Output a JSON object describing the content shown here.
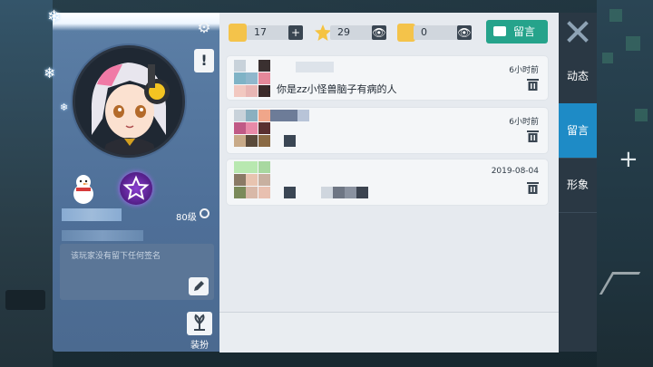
{
  "stats": {
    "home_count": "17",
    "star_count": "29",
    "gift_count": "0"
  },
  "message_button": {
    "label": "留言"
  },
  "tabs": [
    {
      "label": "动态"
    },
    {
      "label": "留言"
    },
    {
      "label": "形象"
    }
  ],
  "profile": {
    "level": "80级",
    "signature": "该玩家没有留下任何签名",
    "dress_label": "装扮"
  },
  "messages": [
    {
      "time": "6小时前",
      "text": "：你是zz小怪兽脑子有病的人"
    },
    {
      "time": "6小时前",
      "text": ""
    },
    {
      "time": "2019-08-04",
      "text": ""
    }
  ],
  "colors": {
    "accent_green": "#25a38b",
    "active_tab": "#1e8bc6",
    "profile_panel": "#5c7fa6"
  }
}
